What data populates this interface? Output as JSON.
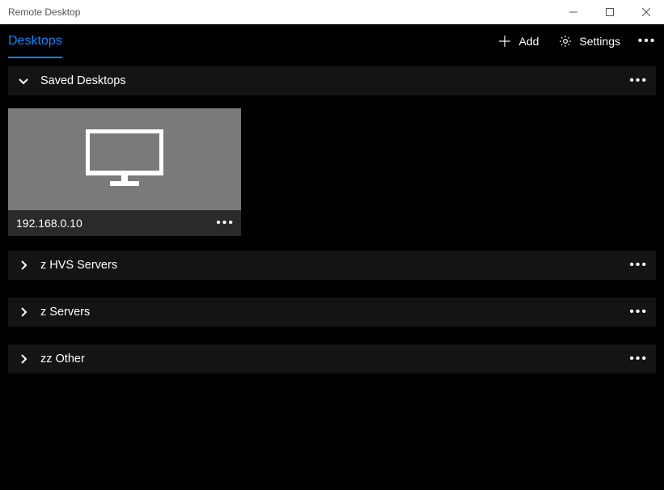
{
  "window": {
    "title": "Remote Desktop"
  },
  "header": {
    "tab_label": "Desktops",
    "add_label": "Add",
    "settings_label": "Settings"
  },
  "groups": [
    {
      "label": "Saved Desktops",
      "expanded": true
    },
    {
      "label": "z HVS Servers",
      "expanded": false
    },
    {
      "label": "z Servers",
      "expanded": false
    },
    {
      "label": "zz Other",
      "expanded": false
    }
  ],
  "tiles": [
    {
      "label": "192.168.0.10"
    }
  ]
}
